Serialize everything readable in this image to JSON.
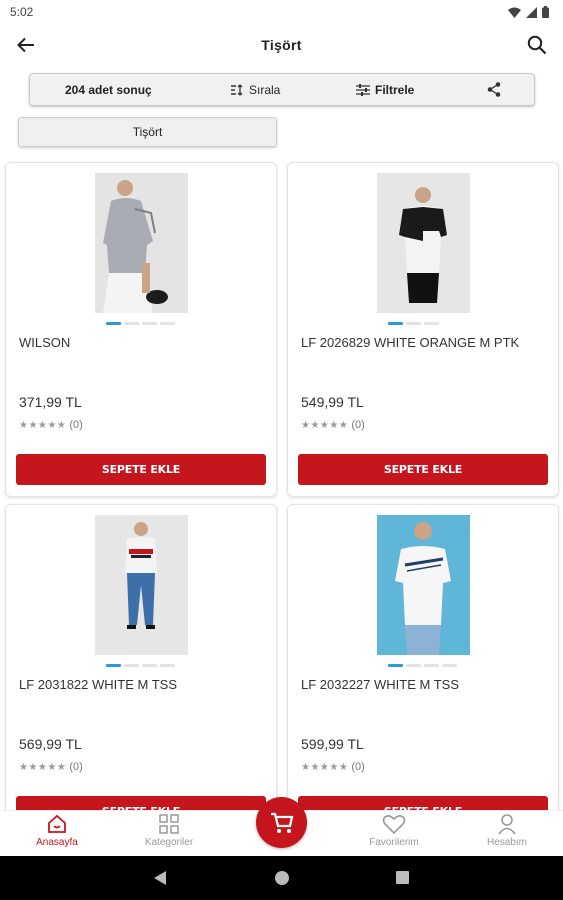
{
  "status": {
    "time": "5:02"
  },
  "header": {
    "title": "Tişört"
  },
  "toolbar": {
    "result_count": "204 adet sonuç",
    "sort_label": "Sırala",
    "filter_label": "Filtrele"
  },
  "filter_chip": "Tişört",
  "products": [
    {
      "name": "WILSON",
      "price": "371,99 TL",
      "stars": "★★★★★",
      "reviews": "(0)",
      "button": "SEPETE EKLE"
    },
    {
      "name": "LF 2026829 WHITE ORANGE M PTK",
      "price": "549,99 TL",
      "stars": "★★★★★",
      "reviews": "(0)",
      "button": "SEPETE EKLE"
    },
    {
      "name": "LF 2031822 WHITE M TSS",
      "price": "569,99 TL",
      "stars": "★★★★★",
      "reviews": "(0)",
      "button": "SEPETE EKLE"
    },
    {
      "name": "LF 2032227 WHITE M TSS",
      "price": "599,99 TL",
      "stars": "★★★★★",
      "reviews": "(0)",
      "button": "SEPETE EKLE"
    }
  ],
  "bottom_nav": {
    "home": "Anasayfa",
    "categories": "Kategoriler",
    "favorites": "Favorilerim",
    "account": "Hesabım"
  },
  "colors": {
    "accent": "#c4161c",
    "dot_active": "#2a9ad8"
  }
}
